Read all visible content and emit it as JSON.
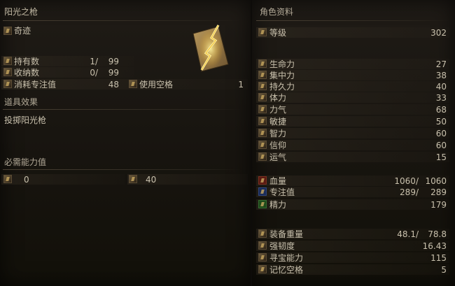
{
  "item": {
    "name": "阳光之枪",
    "category": "奇迹",
    "rows": [
      {
        "label": "持有数",
        "value": "1/",
        "max": "99"
      },
      {
        "label": "收纳数",
        "value": "0/",
        "max": "99"
      },
      {
        "label": "消耗专注值",
        "value": "48"
      }
    ],
    "slots_label": "使用空格",
    "slots_value": "1",
    "effect_header": "道具效果",
    "effect_text": "投掷阳光枪",
    "req_header": "必需能力值",
    "req_a": "0",
    "req_b": "40"
  },
  "stats": {
    "header": "角色资料",
    "level_label": "等级",
    "level_value": "302",
    "attributes": [
      {
        "label": "生命力",
        "value": "27"
      },
      {
        "label": "集中力",
        "value": "38"
      },
      {
        "label": "持久力",
        "value": "40"
      },
      {
        "label": "体力",
        "value": "33"
      },
      {
        "label": "力气",
        "value": "68"
      },
      {
        "label": "敏捷",
        "value": "50"
      },
      {
        "label": "智力",
        "value": "60"
      },
      {
        "label": "信仰",
        "value": "60"
      },
      {
        "label": "运气",
        "value": "15"
      }
    ],
    "hp": {
      "label": "血量",
      "cur": "1060/",
      "max": "1060"
    },
    "fp": {
      "label": "专注值",
      "cur": "289/",
      "max": "289"
    },
    "stamina": {
      "label": "精力",
      "value": "179"
    },
    "equip_load": {
      "label": "装备重量",
      "cur": "48.1/",
      "max": "78.8"
    },
    "poise": {
      "label": "强韧度",
      "value": "16.43"
    },
    "discovery": {
      "label": "寻宝能力",
      "value": "115"
    },
    "attunement": {
      "label": "记忆空格",
      "value": "5"
    }
  }
}
